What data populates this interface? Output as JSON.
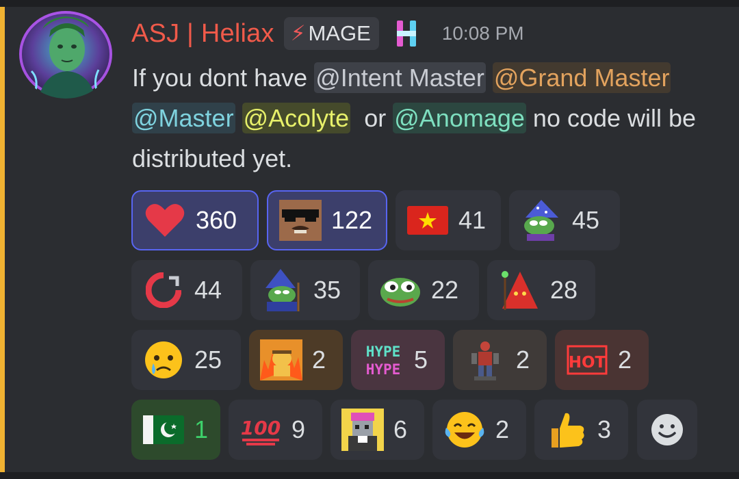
{
  "message": {
    "author": "ASJ | Heliax",
    "role_tag": "MAGE",
    "role_icon": "lightning-bolt-icon",
    "timestamp": "10:08 PM",
    "text_1": "If you dont have ",
    "mention_1": "@Intent Master",
    "mention_2": "@Grand Master",
    "mention_3": "@Master",
    "mention_4": "@Acolyte",
    "text_2": "or",
    "mention_5": "@Anomage",
    "text_3": "no code will be distributed yet."
  },
  "reactions": [
    {
      "emoji": "red-heart-icon",
      "count": "360",
      "selected": true
    },
    {
      "emoji": "deal-with-it-glasses-icon",
      "count": "122",
      "selected": true
    },
    {
      "emoji": "vietnam-flag-icon",
      "count": "41"
    },
    {
      "emoji": "pepe-wizard-icon",
      "count": "45"
    },
    {
      "emoji": "red-circle-logo-icon",
      "count": "44"
    },
    {
      "emoji": "pepe-wizard-blue-icon",
      "count": "35"
    },
    {
      "emoji": "pepe-face-icon",
      "count": "22"
    },
    {
      "emoji": "red-mage-icon",
      "count": "28"
    },
    {
      "emoji": "crying-face-icon",
      "count": "25"
    },
    {
      "emoji": "this-is-fine-dog-icon",
      "count": "2"
    },
    {
      "emoji": "hype-text-icon",
      "count": "5"
    },
    {
      "emoji": "robot-figure-icon",
      "count": "2"
    },
    {
      "emoji": "hot-text-icon",
      "count": "2"
    },
    {
      "emoji": "pakistan-flag-icon",
      "count": "1"
    },
    {
      "emoji": "hundred-points-icon",
      "count": "9"
    },
    {
      "emoji": "pixel-character-icon",
      "count": "6"
    },
    {
      "emoji": "tears-of-joy-icon",
      "count": "2"
    },
    {
      "emoji": "thumbs-up-icon",
      "count": "3"
    }
  ],
  "emoji_labels": {
    "hype": "HYPE",
    "hot": "HOT",
    "hundred": "100"
  },
  "add_reaction": {
    "icon": "smiley-add-reaction-icon"
  },
  "colors": {
    "author": "#f05a4a",
    "accent_bar": "#f0b232",
    "selected_border": "#5865f2",
    "background": "#2b2d31"
  }
}
